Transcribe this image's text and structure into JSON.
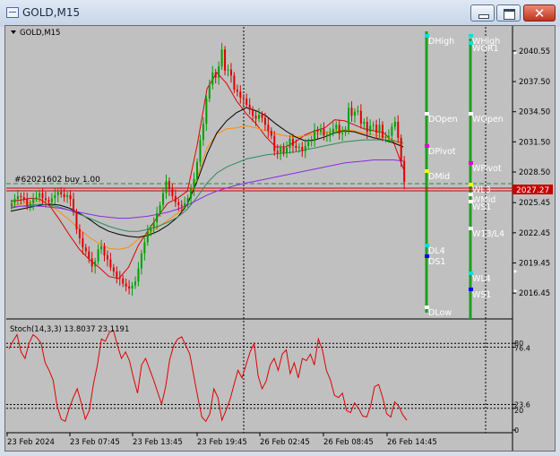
{
  "window": {
    "title": "GOLD,M15",
    "close_glyph": "✕"
  },
  "chart": {
    "symbol_label": "GOLD,M15",
    "order_label": "#62021602 buy 1.00",
    "current_price": "2027.27",
    "price_ticks": [
      "2040.55",
      "2037.50",
      "2034.50",
      "2031.50",
      "2028.50",
      "2025.45",
      "2022.45",
      "2019.45",
      "2016.45"
    ],
    "pivot_labels": [
      "DHigh",
      "DOpen",
      "DPivot",
      "DMid",
      "DL4",
      "DS1",
      "DLow",
      "WHigh",
      "WOR1",
      "WOpen",
      "WPivot",
      "WL3",
      "WMid",
      "WS1",
      "W13/L4",
      "WL4",
      "WS1"
    ],
    "time_labels": [
      "23 Feb 2024",
      "23 Feb 07:45",
      "23 Feb 13:45",
      "23 Feb 19:45",
      "26 Feb 02:45",
      "26 Feb 08:45",
      "26 Feb 14:45"
    ]
  },
  "indicator": {
    "label": "Stoch(14,3,3) 13.8037 23.1191",
    "level_ticks": [
      "80",
      "76.4",
      "23.6",
      "20",
      "0"
    ]
  },
  "colors": {
    "background": "#c0c0c0",
    "bull": "#00a000",
    "bear": "#e00000",
    "stoch": "#e00000",
    "pivot_bar": "#1aa01a"
  },
  "chart_data": {
    "type": "candlestick",
    "symbol": "GOLD",
    "timeframe": "M15",
    "ylim": [
      2014.5,
      2042.5
    ],
    "current_price": 2027.27,
    "order_price": 2027.9,
    "candles_close": [
      2025.4,
      2025.8,
      2026.1,
      2026.0,
      2025.8,
      2025.2,
      2025.4,
      2025.9,
      2026.0,
      2026.4,
      2025.9,
      2025.7,
      2025.5,
      2025.9,
      2026.2,
      2026.5,
      2026.3,
      2026.0,
      2026.2,
      2025.8,
      2024.5,
      2022.8,
      2021.9,
      2021.0,
      2020.6,
      2019.9,
      2019.1,
      2019.6,
      2020.8,
      2021.1,
      2020.2,
      2019.8,
      2019.0,
      2018.6,
      2018.0,
      2017.9,
      2017.4,
      2017.1,
      2016.9,
      2017.2,
      2017.6,
      2018.9,
      2020.4,
      2021.5,
      2022.6,
      2022.9,
      2023.5,
      2024.4,
      2025.2,
      2026.4,
      2027.6,
      2026.8,
      2026.1,
      2025.5,
      2025.2,
      2025.1,
      2025.4,
      2025.9,
      2026.8,
      2027.8,
      2029.5,
      2031.7,
      2033.3,
      2035.8,
      2037.2,
      2038.4,
      2037.9,
      2039.0,
      2040.7,
      2038.6,
      2038.7,
      2038.1,
      2036.7,
      2036.5,
      2035.9,
      2035.8,
      2035.2,
      2034.7,
      2034.1,
      2033.8,
      2034.2,
      2033.9,
      2033.2,
      2032.6,
      2032.1,
      2030.6,
      2030.4,
      2030.9,
      2030.4,
      2030.9,
      2031.8,
      2031.1,
      2030.9,
      2031.0,
      2030.6,
      2031.1,
      2031.5,
      2031.6,
      2032.7,
      2032.5,
      2032.8,
      2032.1,
      2032.2,
      2032.4,
      2032.8,
      2033.2,
      2032.3,
      2032.4,
      2032.7,
      2034.9,
      2034.1,
      2034.5,
      2034.6,
      2033.3,
      2033.5,
      2032.5,
      2033.1,
      2033.2,
      2032.4,
      2033.2,
      2031.9,
      2032.0,
      2032.1,
      2033.0,
      2033.5,
      2031.9,
      2029.6,
      2027.5
    ],
    "moving_averages": [
      {
        "color": "#e00000",
        "values": [
          2025.6,
          2025.7,
          2025.9,
          2025.8,
          2025.1,
          2023.7,
          2022.2,
          2020.8,
          2019.8,
          2019.0,
          2018.1,
          2017.9,
          2019.0,
          2021.2,
          2022.7,
          2024.1,
          2025.4,
          2025.9,
          2026.6,
          2031.2,
          2036.8,
          2038.4,
          2037.3,
          2035.6,
          2034.3,
          2033.3,
          2032.0,
          2031.0,
          2031.0,
          2031.5,
          2032.2,
          2032.6,
          2032.9,
          2033.7,
          2033.6,
          2033.2,
          2032.8,
          2032.6,
          2032.4,
          2031.5,
          2028.8
        ]
      },
      {
        "color": "#ff8c00",
        "values": [
          2025.2,
          2025.3,
          2025.5,
          2025.6,
          2025.2,
          2024.5,
          2023.7,
          2022.8,
          2022.0,
          2021.4,
          2020.9,
          2020.8,
          2021.0,
          2021.8,
          2022.4,
          2023.0,
          2023.7,
          2024.4,
          2025.3,
          2028.0,
          2030.9,
          2032.3,
          2032.8,
          2032.9,
          2033.1,
          2032.9,
          2032.6,
          2032.3,
          2032.1,
          2032.0,
          2032.1,
          2032.3,
          2032.4,
          2032.6,
          2032.7,
          2032.6,
          2032.4,
          2032.2,
          2032.0,
          2031.7,
          2031.0
        ]
      },
      {
        "color": "#000000",
        "values": [
          2024.6,
          2024.8,
          2025.0,
          2025.2,
          2025.3,
          2025.2,
          2024.9,
          2024.4,
          2023.8,
          2023.1,
          2022.6,
          2022.3,
          2022.1,
          2022.0,
          2022.2,
          2022.6,
          2023.2,
          2024.0,
          2025.3,
          2027.6,
          2030.3,
          2032.4,
          2033.6,
          2034.4,
          2034.9,
          2034.6,
          2034.1,
          2033.3,
          2032.6,
          2032.0,
          2031.6,
          2031.7,
          2032.0,
          2032.4,
          2032.6,
          2032.5,
          2032.2,
          2031.9,
          2031.7,
          2031.4,
          2031.0
        ]
      },
      {
        "color": "#2e8b57",
        "values": [
          2024.9,
          2025.1,
          2025.2,
          2025.3,
          2025.2,
          2025.0,
          2024.7,
          2024.3,
          2023.9,
          2023.5,
          2023.1,
          2022.8,
          2022.6,
          2022.6,
          2022.8,
          2023.1,
          2023.5,
          2024.0,
          2024.8,
          2026.0,
          2027.4,
          2028.4,
          2029.0,
          2029.4,
          2029.8,
          2030.0,
          2030.2,
          2030.3,
          2030.4,
          2030.5,
          2030.7,
          2030.9,
          2031.1,
          2031.3,
          2031.5,
          2031.6,
          2031.7,
          2031.7,
          2031.7,
          2031.6,
          2031.4
        ]
      },
      {
        "color": "#8a2be2",
        "values": [
          2025.0,
          2025.1,
          2025.1,
          2025.1,
          2025.0,
          2024.9,
          2024.7,
          2024.5,
          2024.3,
          2024.1,
          2024.0,
          2023.9,
          2023.9,
          2024.0,
          2024.1,
          2024.3,
          2024.5,
          2024.8,
          2025.2,
          2025.7,
          2026.2,
          2026.6,
          2026.9,
          2027.2,
          2027.4,
          2027.6,
          2027.8,
          2028.0,
          2028.2,
          2028.4,
          2028.6,
          2028.8,
          2029.0,
          2029.2,
          2029.4,
          2029.5,
          2029.6,
          2029.7,
          2029.7,
          2029.7,
          2029.6
        ]
      }
    ],
    "stochastic": {
      "name": "Stoch(14,3,3)",
      "main": 13.8037,
      "signal": 23.1191,
      "levels": [
        80,
        76.4,
        23.6,
        20
      ],
      "ylim": [
        0,
        100
      ],
      "values": [
        75,
        82,
        88,
        72,
        66,
        80,
        88,
        85,
        80,
        62,
        55,
        46,
        22,
        10,
        8,
        20,
        30,
        38,
        25,
        10,
        18,
        42,
        60,
        84,
        82,
        90,
        92,
        78,
        66,
        72,
        64,
        48,
        34,
        60,
        66,
        56,
        46,
        35,
        24,
        40,
        65,
        78,
        84,
        86,
        78,
        70,
        50,
        30,
        12,
        8,
        15,
        38,
        30,
        9,
        18,
        28,
        42,
        55,
        48,
        60,
        72,
        80,
        50,
        38,
        45,
        60,
        66,
        55,
        70,
        74,
        52,
        62,
        48,
        66,
        64,
        70,
        60,
        84,
        74,
        55,
        46,
        32,
        30,
        34,
        18,
        16,
        25,
        20,
        13,
        12,
        22,
        40,
        42,
        30,
        15,
        12,
        26,
        22,
        14,
        9
      ]
    }
  }
}
